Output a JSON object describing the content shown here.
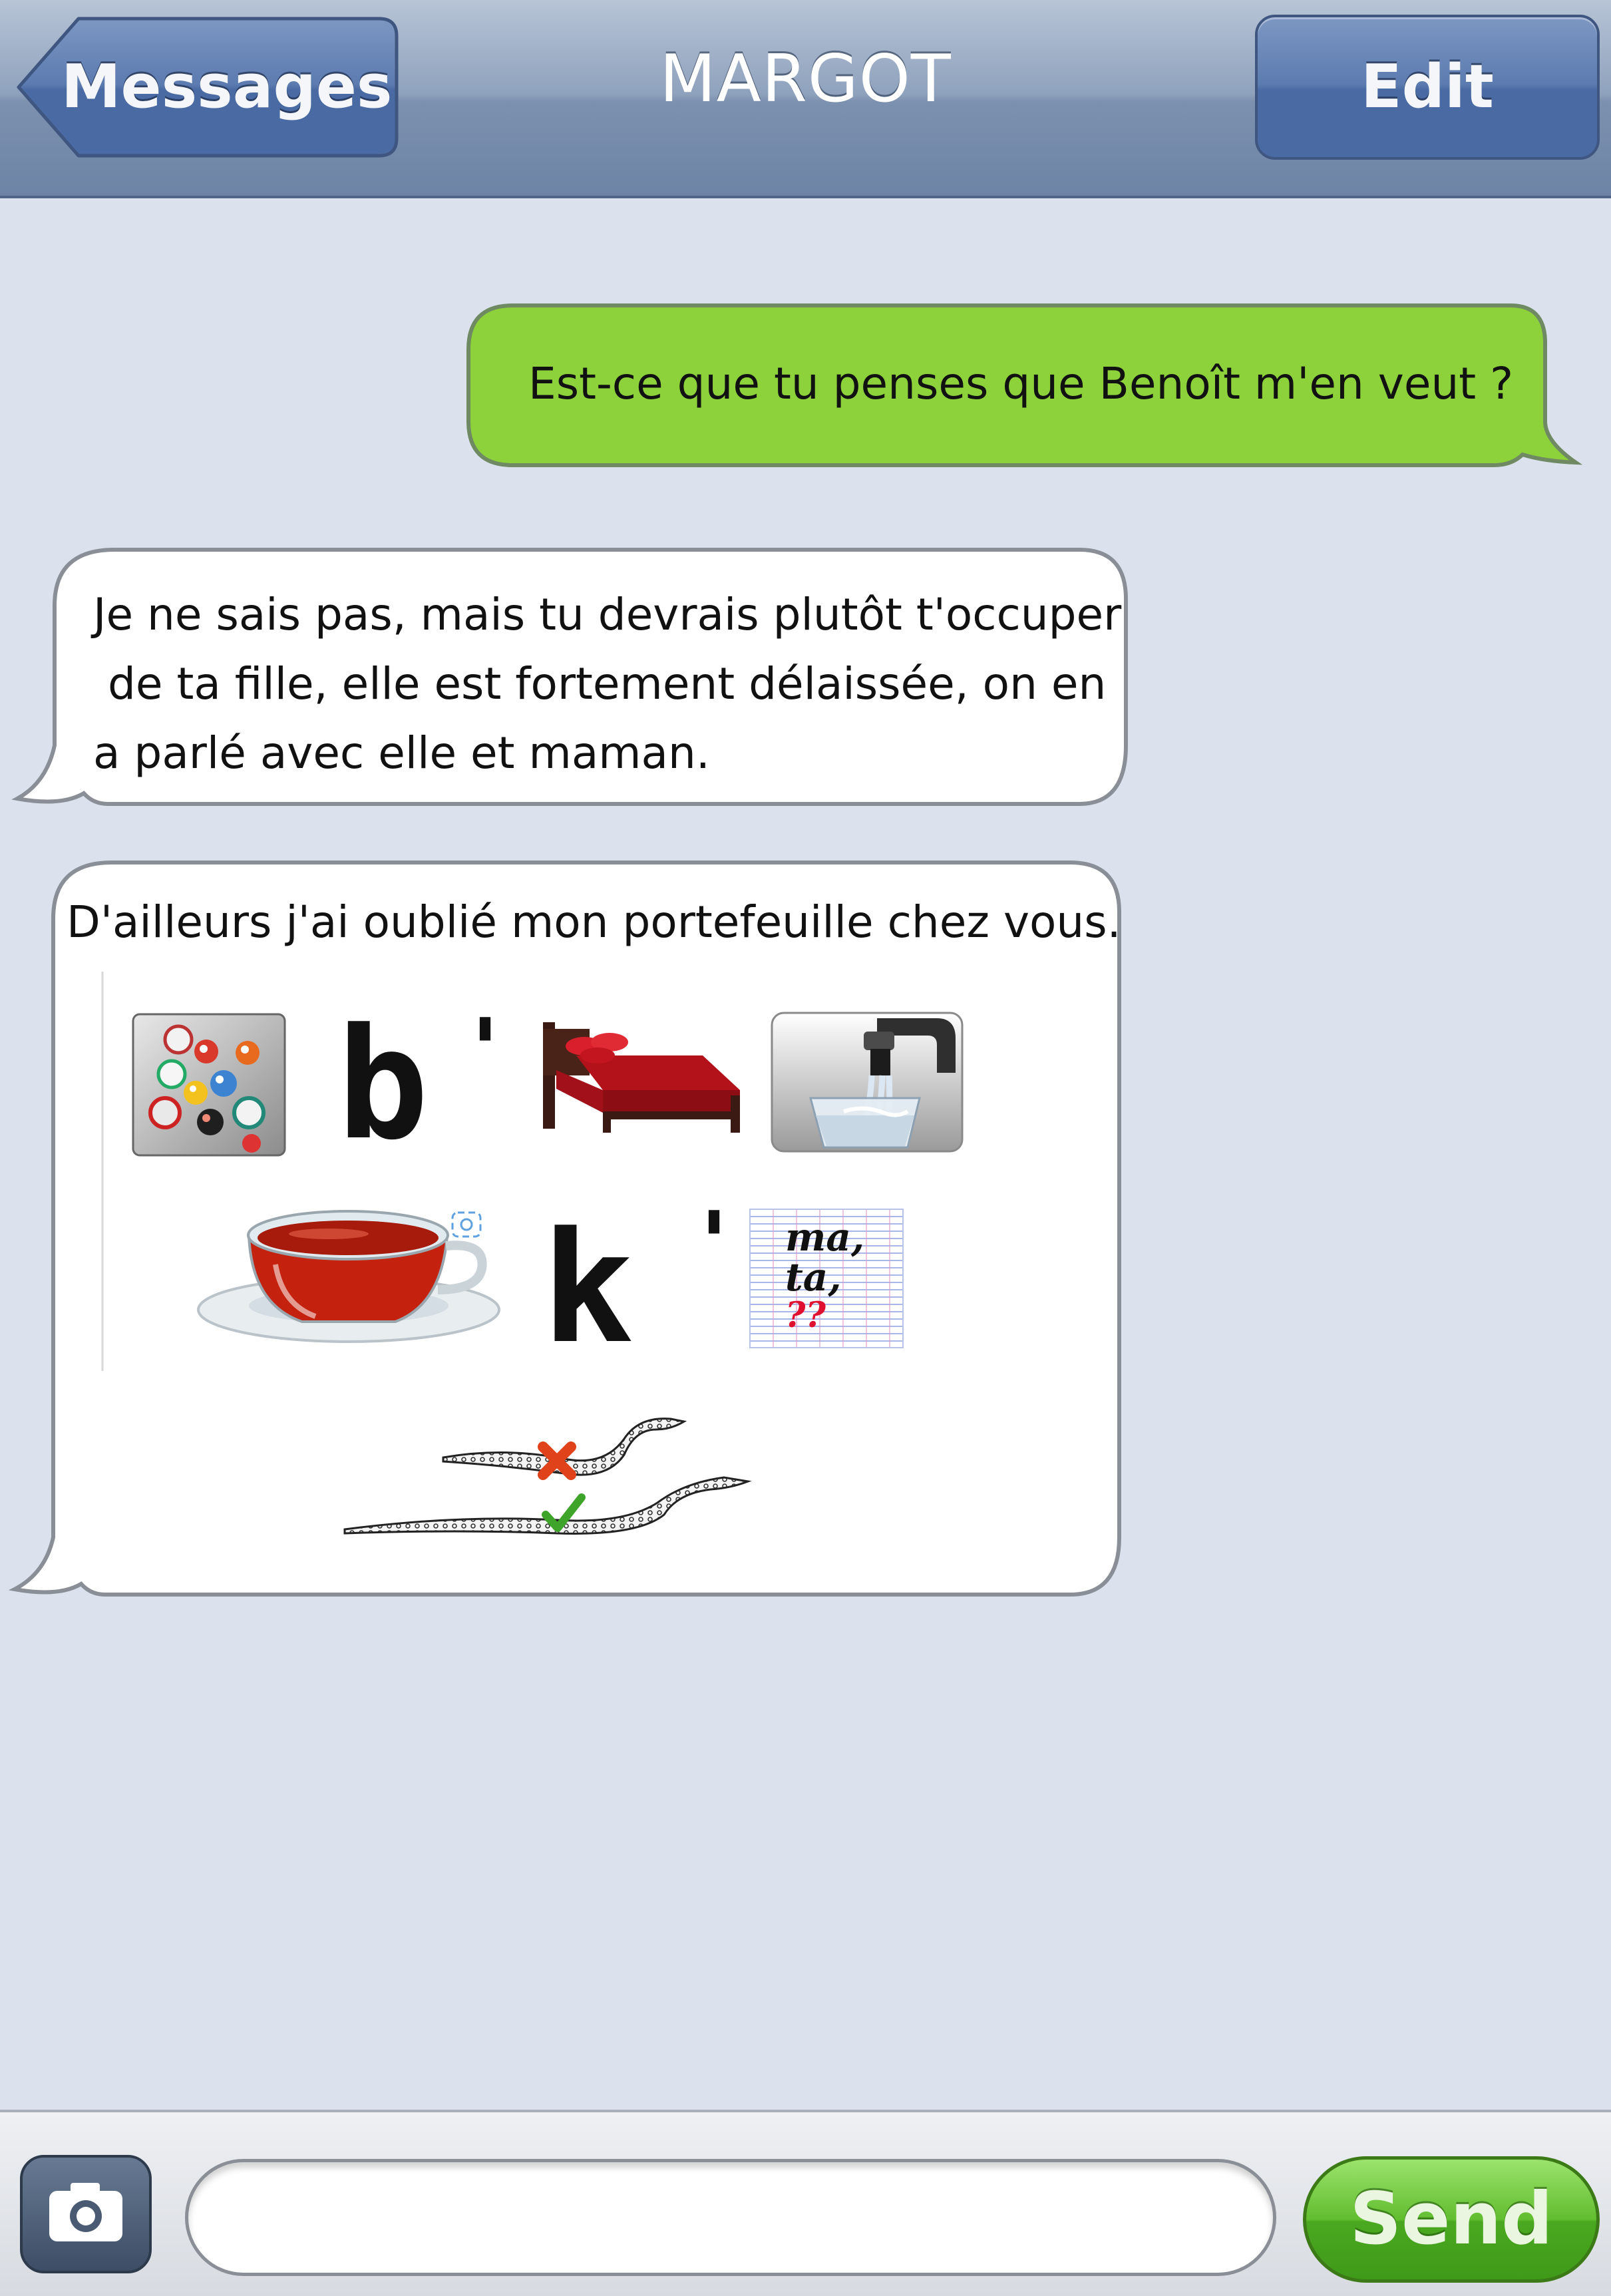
{
  "header": {
    "back_label": "Messages",
    "title": "MARGOT",
    "edit_label": "Edit"
  },
  "messages": [
    {
      "side": "sent",
      "color": "#8dd23a",
      "lines": [
        "Est-ce que tu penses que Benoît m'en veut ?"
      ]
    },
    {
      "side": "received",
      "color": "#ffffff",
      "lines": [
        "Je ne sais pas, mais tu devrais plutôt t'occuper",
        "de ta fille, elle est fortement délaissée, on en",
        "a parlé avec elle et maman."
      ]
    },
    {
      "side": "received",
      "color": "#ffffff",
      "lines": [
        "D'ailleurs j'ai oublié mon portefeuille chez vous."
      ],
      "rebus": {
        "row1": [
          "marbles-image",
          "b",
          "'",
          "bed-image",
          "water-glass-image"
        ],
        "row2": [
          "tea-cup-image",
          "k",
          "'",
          "notebook-image"
        ],
        "row3": [
          "snakes-image"
        ],
        "notebook_lines": [
          "ma,",
          "ta,",
          "??"
        ]
      }
    }
  ],
  "composer": {
    "placeholder": "",
    "send_label": "Send",
    "camera_icon": "camera-icon"
  }
}
